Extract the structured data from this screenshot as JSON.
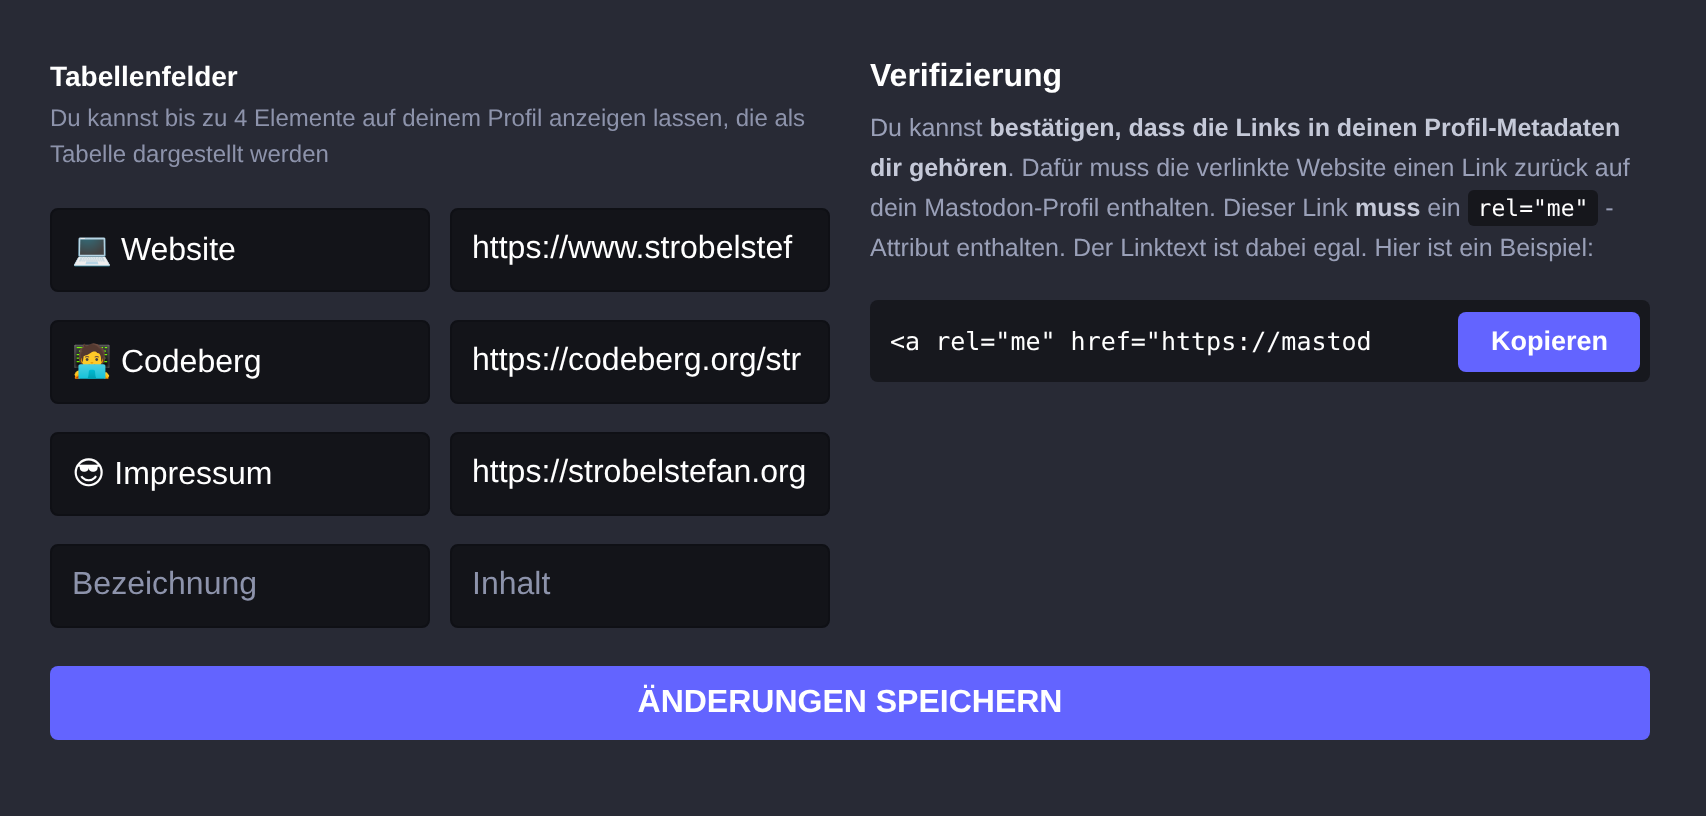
{
  "table_fields": {
    "title": "Tabellenfelder",
    "hint": "Du kannst bis zu 4 Elemente auf deinem Profil anzeigen lassen, die als Tabelle dargestellt werden",
    "rows": [
      {
        "label": "💻 Website",
        "content": "https://www.strobelstef"
      },
      {
        "label": "🧑‍💻 Codeberg",
        "content": "https://codeberg.org/str"
      },
      {
        "label": "😎 Impressum",
        "content": "https://strobelstefan.org"
      },
      {
        "label_placeholder": "Bezeichnung",
        "content_placeholder": "Inhalt"
      }
    ]
  },
  "verification": {
    "title": "Verifizierung",
    "text_before": "Du kannst **bestätigen, dass die Links in deinen Profil-Metadaten dir gehören**. Dafür muss die verlinkte Website einen Link zurück auf dein Mastodon-Profil enthalten. Dieser Link **muss** ein",
    "code": "rel=\"me\"",
    "text_after": "-Attribut enthalten. Der Linktext ist dabei egal. Hier ist ein Beispiel:",
    "example": "<a rel=\"me\" href=\"https://mastod",
    "copy_button": "Kopieren"
  },
  "save_button": "ÄNDERUNGEN SPEICHERN"
}
